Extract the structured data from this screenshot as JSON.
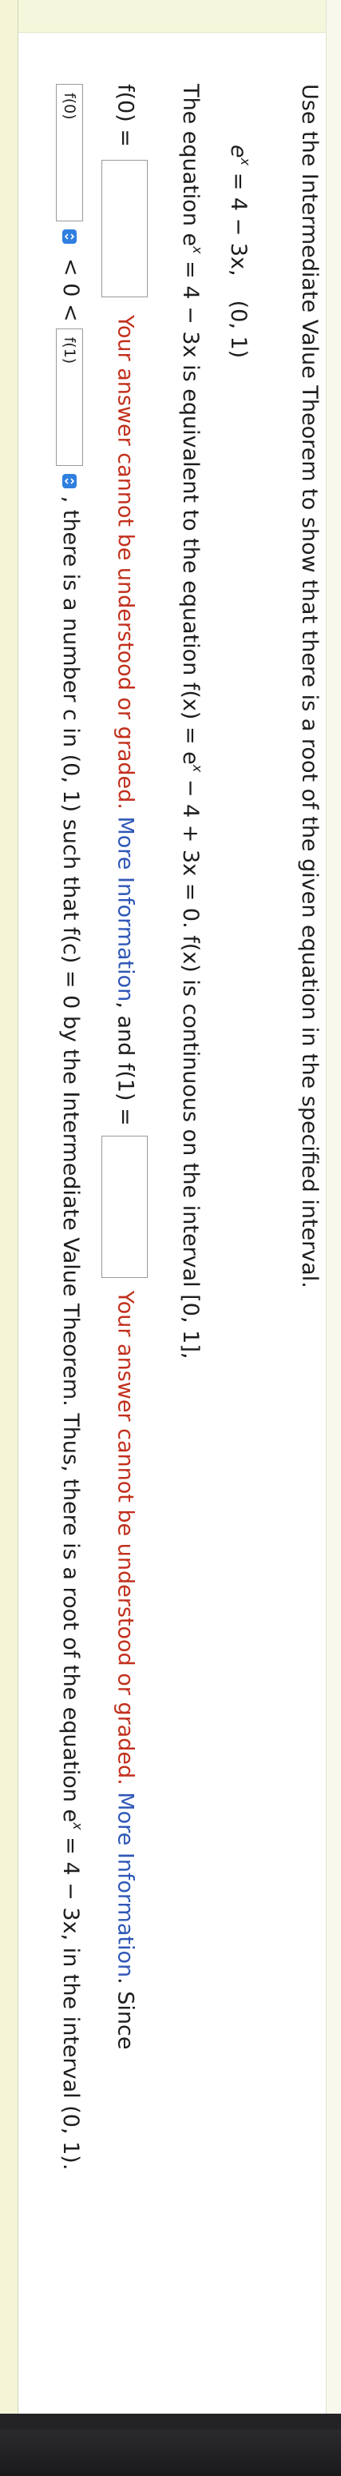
{
  "prompt": {
    "instruction": "Use the Intermediate Value Theorem to show that there is a root of the given equation in the specified interval."
  },
  "equation": {
    "lhs_base": "e",
    "lhs_exp": "x",
    "rhs": "= 4 − 3x,",
    "interval": "(0, 1)"
  },
  "line3": {
    "pre": "The equation e",
    "exp1": "x",
    "mid": " = 4 − 3x is equivalent to the equation f(x) = e",
    "exp2": "x",
    "post": " − 4 + 3x = 0. f(x) is continuous on the interval [0, 1],"
  },
  "line4": {
    "f0_label": "f(0) =",
    "error_1": "Your answer cannot be understood or graded.",
    "more_info_1": "More Information",
    "and_f1": ", and f(1) =",
    "error_2": "Your answer cannot be understood or graded.",
    "more_info_2": "More Information",
    "since": ". Since"
  },
  "line5": {
    "f0_field": "f(0)",
    "lt1": "< 0 <",
    "f1_field": "f(1)",
    "conclusion_pre": ", there is a number c in (0, 1) such that f(c) = 0 by the Intermediate Value Theorem. Thus, there is a root of the equation e",
    "exp": "x",
    "conclusion_post": " = 4 − 3x, in the interval (0, 1)."
  },
  "colors": {
    "error": "#c2301d",
    "link": "#2f57b7",
    "dropdown": "#2f7fe0"
  }
}
